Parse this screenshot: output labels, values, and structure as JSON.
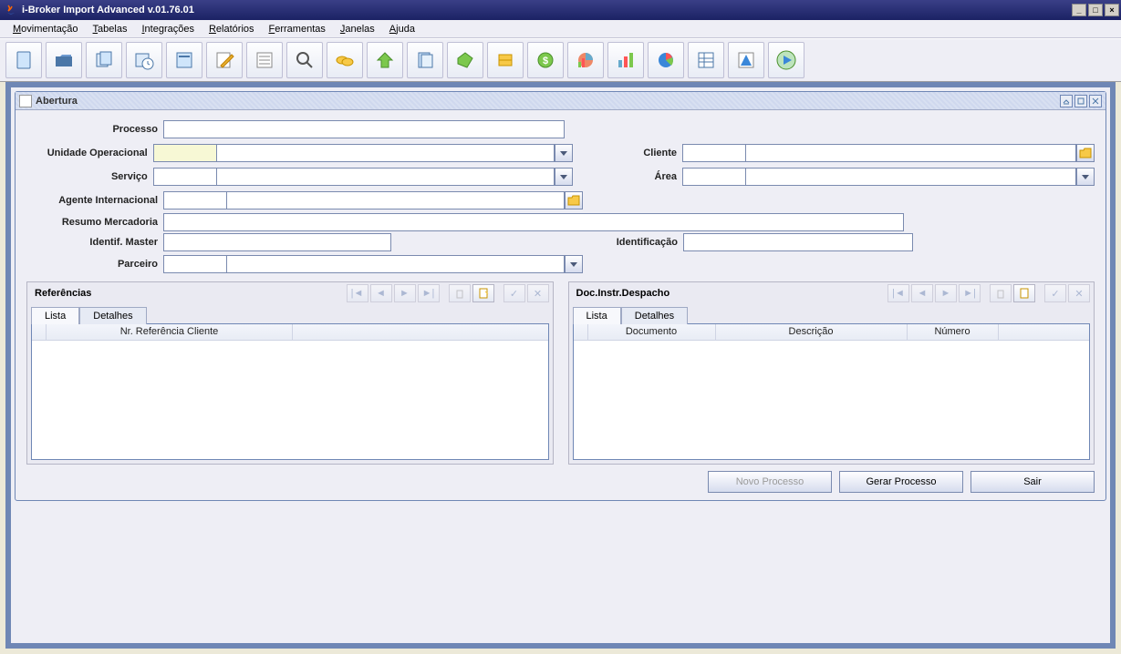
{
  "window": {
    "title": "i-Broker Import Advanced v.01.76.01"
  },
  "menubar": {
    "items": [
      "Movimentação",
      "Tabelas",
      "Integrações",
      "Relatórios",
      "Ferramentas",
      "Janelas",
      "Ajuda"
    ]
  },
  "toolbar_icons": [
    "document-icon",
    "folder-open-icon",
    "files-icon",
    "clock-icon",
    "page-icon",
    "edit-icon",
    "list-icon",
    "search-icon",
    "coins-icon",
    "arrow-up-icon",
    "notes-icon",
    "tag-icon",
    "stack-icon",
    "globe-money-icon",
    "chart-pie-icon",
    "chart-bar-icon",
    "pie-icon",
    "grid-icon",
    "triangle-icon",
    "play-icon"
  ],
  "internal_window": {
    "title": "Abertura"
  },
  "form": {
    "processo": {
      "label": "Processo",
      "value": ""
    },
    "unidade": {
      "label": "Unidade Operacional",
      "code": "",
      "desc": ""
    },
    "cliente": {
      "label": "Cliente",
      "code": "",
      "desc": ""
    },
    "servico": {
      "label": "Serviço",
      "code": "",
      "desc": ""
    },
    "area": {
      "label": "Área",
      "code": "",
      "desc": ""
    },
    "agente": {
      "label": "Agente Internacional",
      "code": "",
      "desc": ""
    },
    "resumo": {
      "label": "Resumo Mercadoria",
      "value": ""
    },
    "identif_master": {
      "label": "Identif. Master",
      "value": ""
    },
    "identificacao": {
      "label": "Identificação",
      "value": ""
    },
    "parceiro": {
      "label": "Parceiro",
      "code": "",
      "desc": ""
    }
  },
  "panel_refs": {
    "title": "Referências",
    "tabs": [
      "Lista",
      "Detalhes"
    ],
    "columns": [
      "Nr. Referência Cliente"
    ]
  },
  "panel_docs": {
    "title": "Doc.Instr.Despacho",
    "tabs": [
      "Lista",
      "Detalhes"
    ],
    "columns": [
      "Documento",
      "Descrição",
      "Número"
    ]
  },
  "buttons": {
    "novo": "Novo Processo",
    "gerar": "Gerar Processo",
    "sair": "Sair"
  }
}
